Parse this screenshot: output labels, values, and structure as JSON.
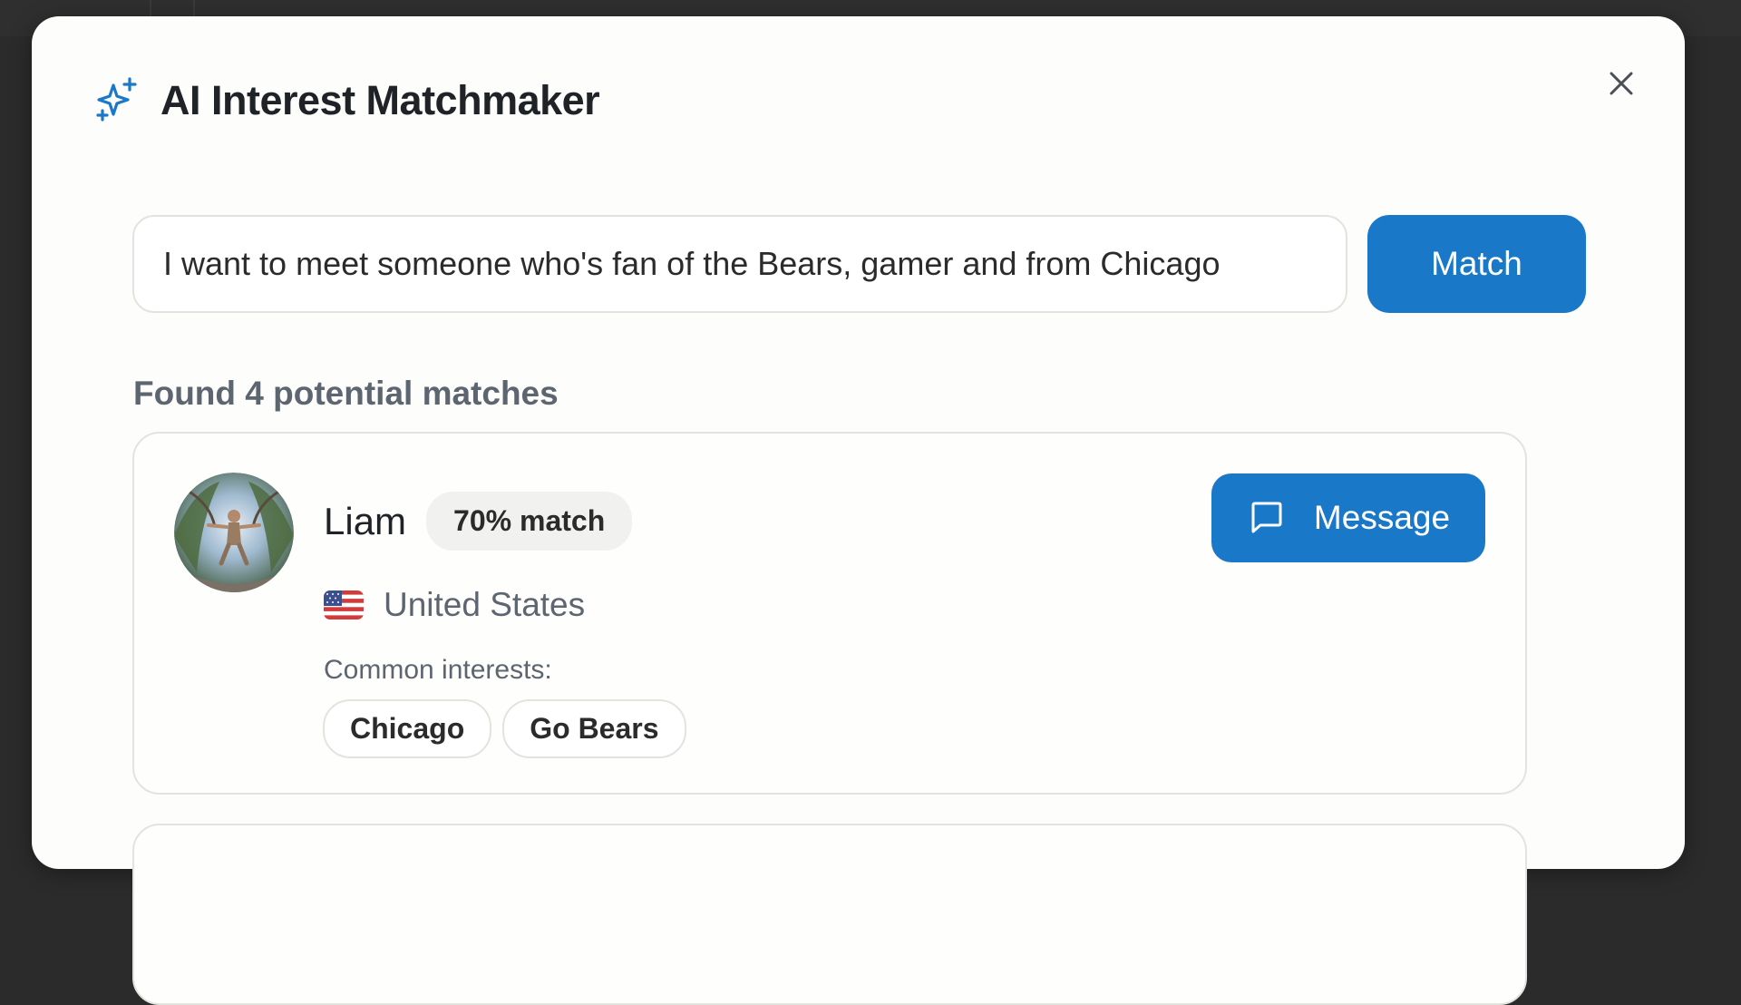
{
  "modal": {
    "title": "AI Interest Matchmaker"
  },
  "search": {
    "value": "I want to meet someone who's fan of the Bears, gamer and from Chicago",
    "button_label": "Match"
  },
  "results": {
    "count_text": "Found 4 potential matches",
    "matches": [
      {
        "name": "Liam",
        "match_percent": "70% match",
        "country": "United States",
        "flag": "us-flag-icon",
        "common_interests_label": "Common interests:",
        "interests": [
          "Chicago",
          "Go Bears"
        ],
        "message_label": "Message"
      }
    ]
  },
  "colors": {
    "accent": "#1a78c8",
    "modal_bg": "#fdfdfb",
    "backdrop": "#2b2b2b"
  }
}
